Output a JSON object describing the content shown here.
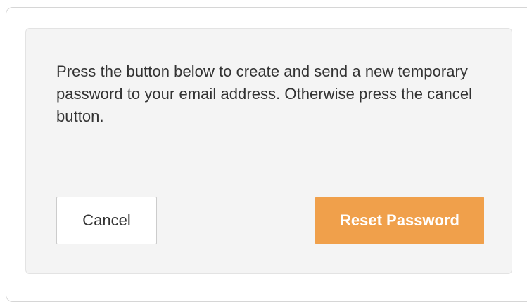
{
  "dialog": {
    "message": "Press the button below to create and send a new temporary password to your email address. Otherwise press the cancel button.",
    "cancel_label": "Cancel",
    "reset_label": "Reset Password"
  },
  "colors": {
    "accent": "#f0a04b",
    "panel_background": "#f4f4f4"
  }
}
